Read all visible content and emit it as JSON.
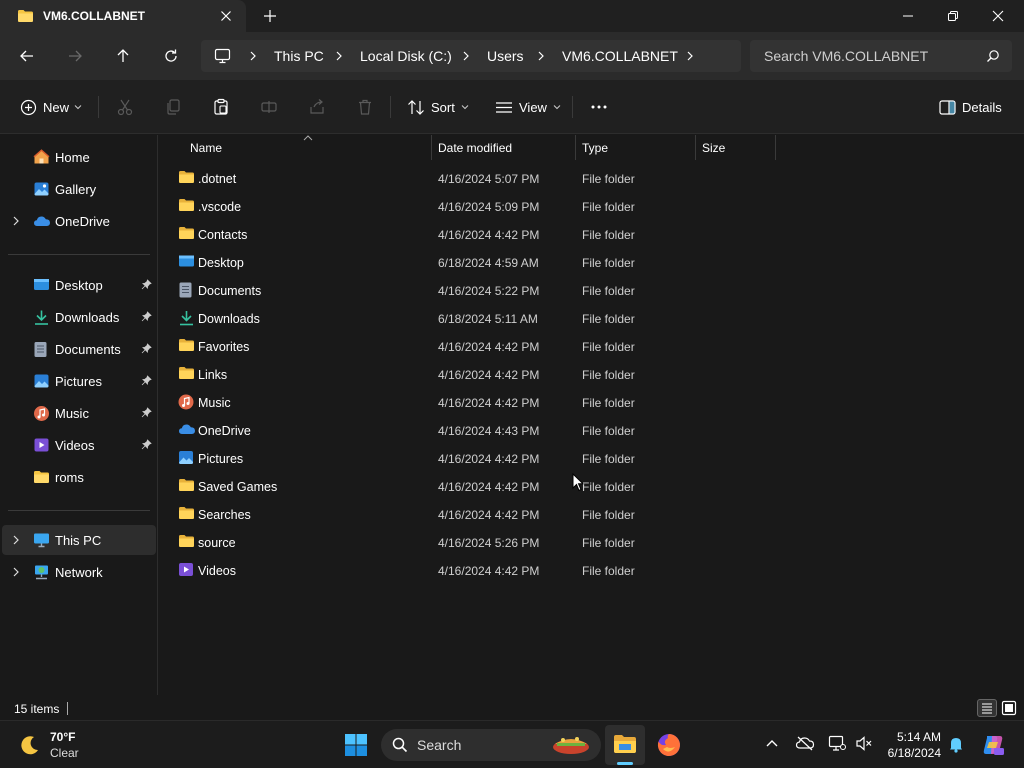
{
  "window": {
    "tab_title": "VM6.COLLABNET"
  },
  "address": {
    "crumbs": [
      "This PC",
      "Local Disk (C:)",
      "Users",
      "VM6.COLLABNET"
    ],
    "search_placeholder": "Search VM6.COLLABNET"
  },
  "toolbar": {
    "new_label": "New",
    "sort_label": "Sort",
    "view_label": "View",
    "details_label": "Details"
  },
  "sidebar": {
    "items": [
      {
        "label": "Home",
        "icon": "home-icon"
      },
      {
        "label": "Gallery",
        "icon": "gallery-icon"
      },
      {
        "label": "OneDrive",
        "icon": "onedrive-icon"
      },
      {
        "label": "Desktop",
        "icon": "desktop-icon"
      },
      {
        "label": "Downloads",
        "icon": "downloads-icon"
      },
      {
        "label": "Documents",
        "icon": "documents-icon"
      },
      {
        "label": "Pictures",
        "icon": "pictures-icon"
      },
      {
        "label": "Music",
        "icon": "music-icon"
      },
      {
        "label": "Videos",
        "icon": "videos-icon"
      },
      {
        "label": "roms",
        "icon": "folder-icon"
      },
      {
        "label": "This PC",
        "icon": "this-pc-icon"
      },
      {
        "label": "Network",
        "icon": "network-icon"
      }
    ]
  },
  "columns": {
    "name": "Name",
    "date": "Date modified",
    "type": "Type",
    "size": "Size"
  },
  "files": [
    {
      "name": ".dotnet",
      "date": "4/16/2024 5:07 PM",
      "type": "File folder",
      "icon": "folder-icon"
    },
    {
      "name": ".vscode",
      "date": "4/16/2024 5:09 PM",
      "type": "File folder",
      "icon": "folder-icon"
    },
    {
      "name": "Contacts",
      "date": "4/16/2024 4:42 PM",
      "type": "File folder",
      "icon": "folder-icon"
    },
    {
      "name": "Desktop",
      "date": "6/18/2024 4:59 AM",
      "type": "File folder",
      "icon": "desktop-icon"
    },
    {
      "name": "Documents",
      "date": "4/16/2024 5:22 PM",
      "type": "File folder",
      "icon": "documents-icon"
    },
    {
      "name": "Downloads",
      "date": "6/18/2024 5:11 AM",
      "type": "File folder",
      "icon": "downloads-icon"
    },
    {
      "name": "Favorites",
      "date": "4/16/2024 4:42 PM",
      "type": "File folder",
      "icon": "folder-icon"
    },
    {
      "name": "Links",
      "date": "4/16/2024 4:42 PM",
      "type": "File folder",
      "icon": "folder-icon"
    },
    {
      "name": "Music",
      "date": "4/16/2024 4:42 PM",
      "type": "File folder",
      "icon": "music-icon"
    },
    {
      "name": "OneDrive",
      "date": "4/16/2024 4:43 PM",
      "type": "File folder",
      "icon": "onedrive-icon"
    },
    {
      "name": "Pictures",
      "date": "4/16/2024 4:42 PM",
      "type": "File folder",
      "icon": "pictures-icon"
    },
    {
      "name": "Saved Games",
      "date": "4/16/2024 4:42 PM",
      "type": "File folder",
      "icon": "folder-icon"
    },
    {
      "name": "Searches",
      "date": "4/16/2024 4:42 PM",
      "type": "File folder",
      "icon": "folder-icon"
    },
    {
      "name": "source",
      "date": "4/16/2024 5:26 PM",
      "type": "File folder",
      "icon": "folder-icon"
    },
    {
      "name": "Videos",
      "date": "4/16/2024 4:42 PM",
      "type": "File folder",
      "icon": "videos-icon"
    }
  ],
  "status": {
    "item_count": "15 items"
  },
  "taskbar": {
    "weather_temp": "70°F",
    "weather_desc": "Clear",
    "search_label": "Search",
    "time": "5:14 AM",
    "date": "6/18/2024"
  },
  "colors": {
    "folder": "#f5c542",
    "accent": "#60cdff",
    "selected": "#2d2d2d"
  }
}
